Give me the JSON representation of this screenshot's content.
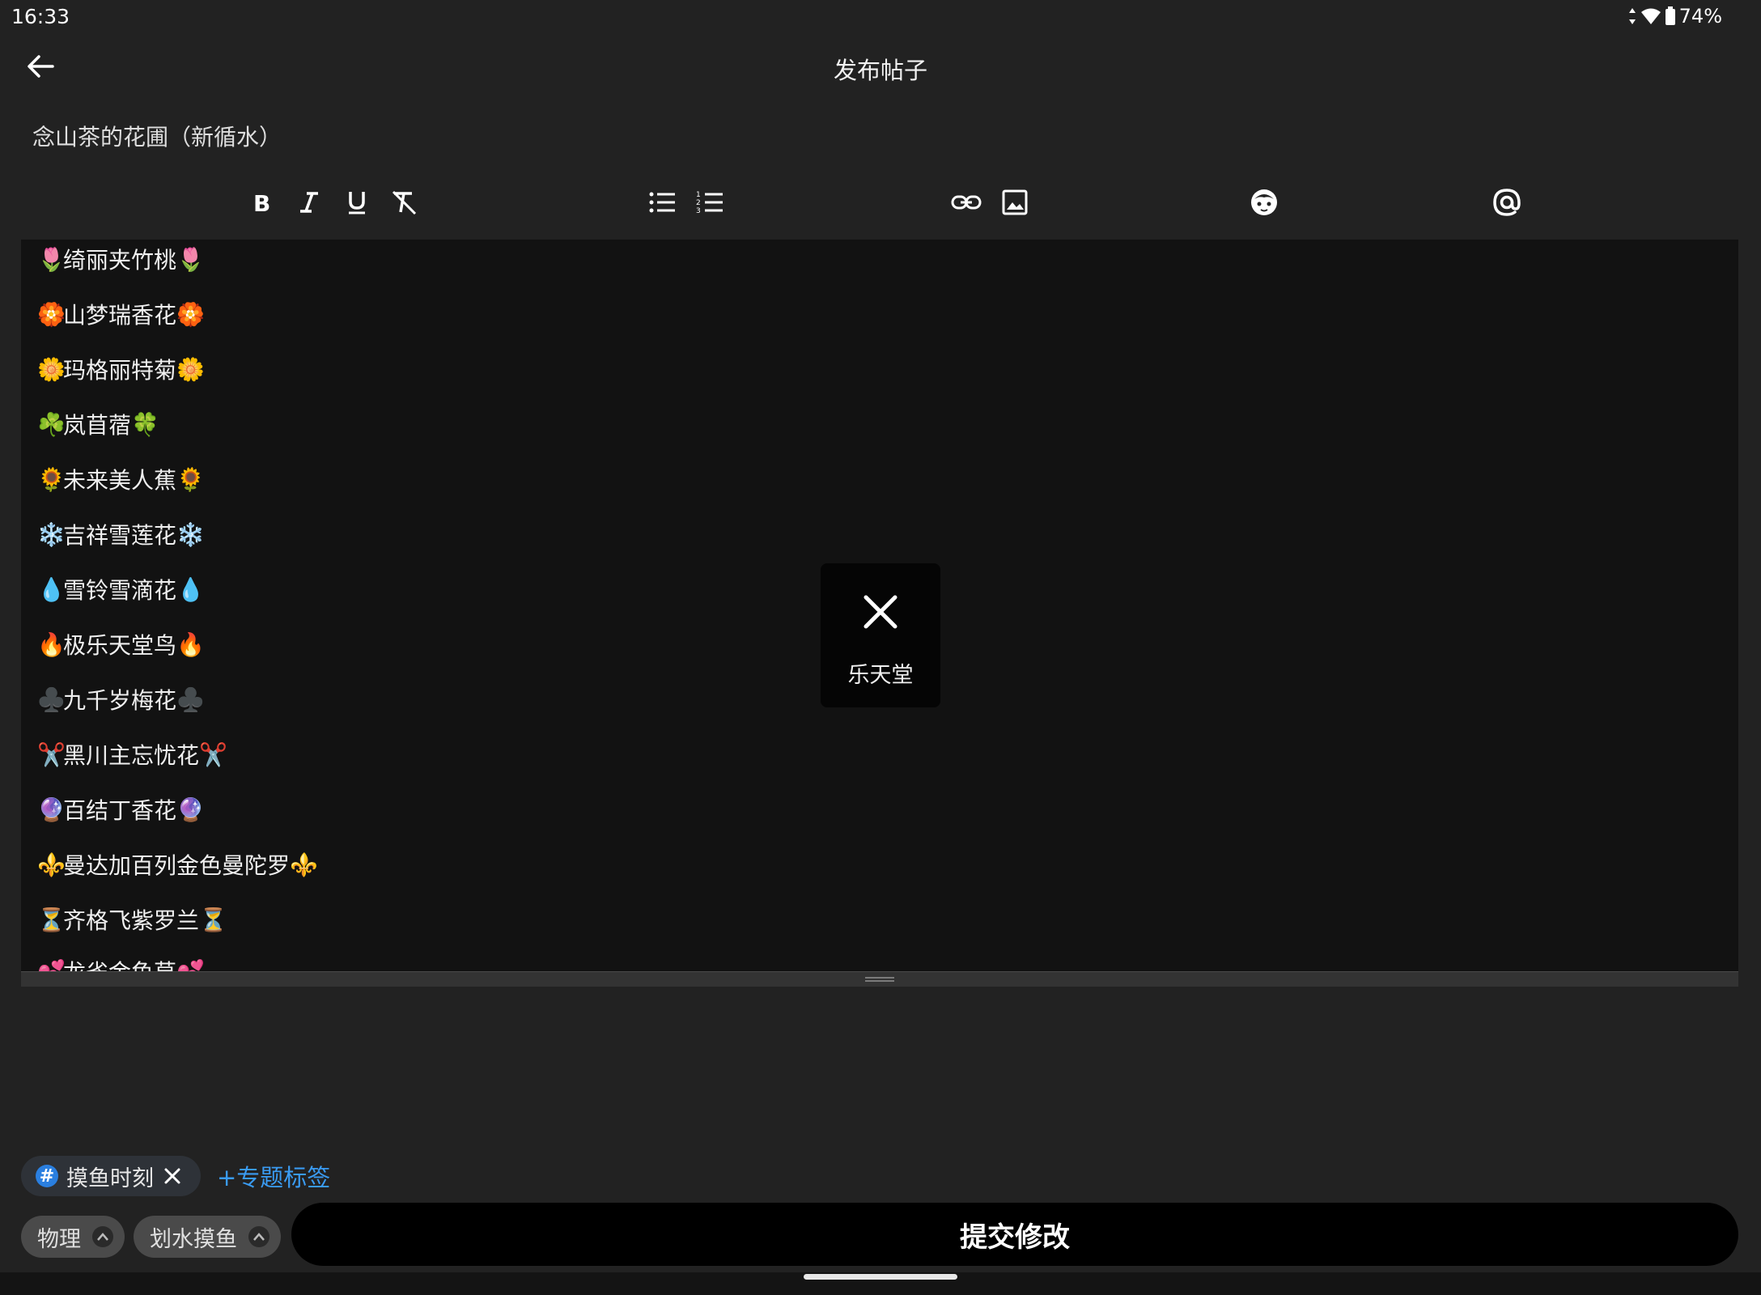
{
  "status": {
    "time": "16:33",
    "battery": "74%"
  },
  "header": {
    "title": "发布帖子",
    "back_icon": "arrow-left-icon"
  },
  "post": {
    "title": "念山茶的花圃（新循水）"
  },
  "toolbar": {
    "icons": [
      "bold-icon",
      "italic-icon",
      "underline-icon",
      "clear-format-icon",
      "bullet-list-icon",
      "numbered-list-icon",
      "link-icon",
      "image-icon",
      "emoji-icon",
      "mention-icon"
    ]
  },
  "editor": {
    "lines": [
      {
        "emoji": "🌷",
        "text": "绮丽夹竹桃"
      },
      {
        "emoji": "🏵️",
        "text": "山梦瑞香花"
      },
      {
        "emoji": "🌼",
        "text": "玛格丽特菊"
      },
      {
        "emoji": "☘️",
        "text": "岚苜蓿",
        "end_emoji": "🍀"
      },
      {
        "emoji": "🌻",
        "text": "未来美人蕉"
      },
      {
        "emoji": "❄️",
        "text": "吉祥雪莲花"
      },
      {
        "emoji": "💧",
        "text": "雪铃雪滴花"
      },
      {
        "emoji": "🔥",
        "text": "极乐天堂鸟"
      },
      {
        "emoji": "♣️",
        "text": "九千岁梅花"
      },
      {
        "emoji": "✂️",
        "text": "黑川主忘忧花"
      },
      {
        "emoji": "🔮",
        "text": "百结丁香花"
      },
      {
        "emoji": "⚜️",
        "text": "曼达加百列金色曼陀罗"
      },
      {
        "emoji": "⏳",
        "text": "齐格飞紫罗兰"
      },
      {
        "emoji": "💕",
        "text": "龙雀金鱼草"
      }
    ]
  },
  "toast": {
    "label": "乐天堂",
    "icon": "close-icon"
  },
  "tags": {
    "topic_chip": {
      "hash": "#",
      "label": "摸鱼时刻"
    },
    "add_topic": "+专题标签"
  },
  "categories": [
    {
      "label": "物理"
    },
    {
      "label": "划水摸鱼"
    }
  ],
  "submit": {
    "label": "提交修改"
  },
  "colors": {
    "accent": "#3a9bf2",
    "hash_badge": "#2a7fe0",
    "background": "#222222",
    "editor_bg": "#121212"
  }
}
